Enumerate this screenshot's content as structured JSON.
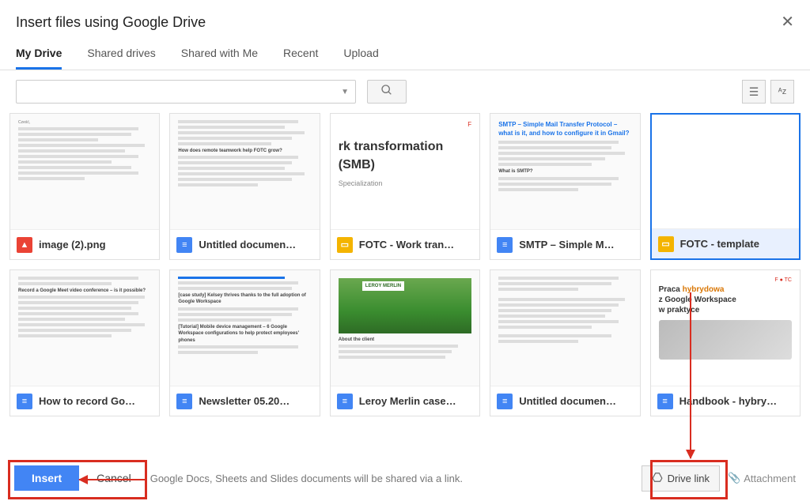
{
  "dialog": {
    "title": "Insert files using Google Drive"
  },
  "tabs": {
    "my_drive": "My Drive",
    "shared_drives": "Shared drives",
    "shared_with_me": "Shared with Me",
    "recent": "Recent",
    "upload": "Upload"
  },
  "files": {
    "row1": [
      {
        "title": "image (2).png",
        "type": "img"
      },
      {
        "title": "Untitled documen…",
        "type": "docs"
      },
      {
        "title": "FOTC - Work tran…",
        "type": "slides"
      },
      {
        "title": "SMTP – Simple M…",
        "type": "docs"
      },
      {
        "title": "FOTC - template",
        "type": "slides",
        "selected": true
      }
    ],
    "row2": [
      {
        "title": "How to record Go…",
        "type": "docs"
      },
      {
        "title": "Newsletter 05.20…",
        "type": "docs"
      },
      {
        "title": "Leroy Merlin case…",
        "type": "docs"
      },
      {
        "title": "Untitled documen…",
        "type": "docs"
      },
      {
        "title": "Handbook - hybry…",
        "type": "docs"
      }
    ]
  },
  "thumbs": {
    "work_trans_heading": "rk transformation (SMB)",
    "work_trans_sub": "Specialization",
    "smtp_title": "SMTP – Simple Mail Transfer Protocol – what is it, and how to configure it in Gmail?",
    "smtp_sub": "What is SMTP?",
    "handbook_l1": "Praca ",
    "handbook_l1_hy": "hybrydowa",
    "handbook_l2": "z Google Workspace",
    "handbook_l3": "w praktyce",
    "howto_heading": "Record a Google Meet video conference – is it possible?",
    "news_h1": "[case study] Kelsey thrives thanks to the full adoption of Google Workspace",
    "news_h2": "[Tutorial] Mobile device management – 6 Google Workspace configurations to help protect employees' phones",
    "leroy_sub": "About the client",
    "untitled_h": "How does remote teamwork help FOTC grow?"
  },
  "bottom": {
    "insert": "Insert",
    "cancel": "Cancel",
    "note": "Google Docs, Sheets and Slides documents will be shared via a link.",
    "drive_link": "Drive link",
    "attachment": "Attachment"
  }
}
